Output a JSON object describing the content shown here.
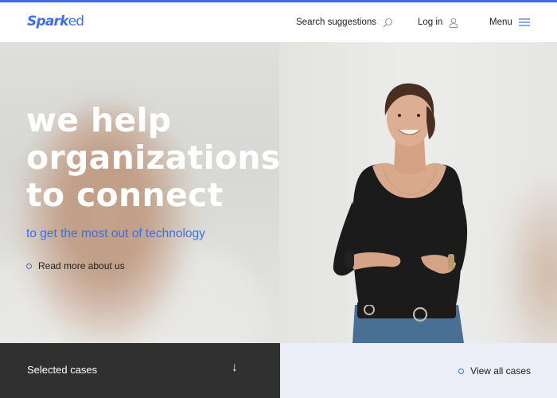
{
  "brand": {
    "logo_text_main": "Spark",
    "logo_text_accent": "ed",
    "accent_color": "#3e6fe0",
    "dark_color": "#303030",
    "light_panel_color": "#ebeef7"
  },
  "header": {
    "search_label": "Search suggestions",
    "search_icon": "search-icon",
    "login_label": "Log in",
    "login_icon": "user-icon",
    "menu_label": "Menu",
    "menu_icon": "hamburger-icon"
  },
  "hero": {
    "headline_lines": [
      "we help",
      "organizations",
      "to connect"
    ],
    "subline": "to get the most out of technology",
    "read_more_label": "Read more about us",
    "images": {
      "left": "blurred-person-photo",
      "right": "smiling-woman-presenting-photo"
    }
  },
  "bottom": {
    "selected_cases_label": "Selected cases",
    "down_arrow": "↓",
    "view_all_label": "View all cases"
  }
}
